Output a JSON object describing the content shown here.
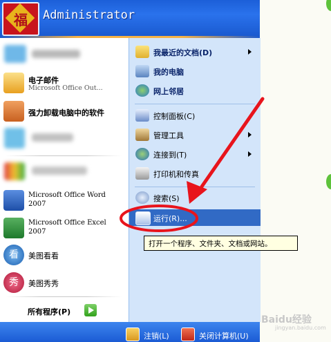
{
  "header": {
    "username": "Administrator",
    "avatar_glyph": "福"
  },
  "left_items": [
    {
      "icon": "outlook-mail-icon",
      "title": "电子邮件",
      "subtitle": "Microsoft Office Out..."
    },
    {
      "icon": "uninstall-tool-icon",
      "title": "强力卸载电脑中的软件"
    },
    {
      "icon": "word-icon",
      "title": "Microsoft Office Word",
      "subtitle": "2007"
    },
    {
      "icon": "excel-icon",
      "title": "Microsoft Office Excel",
      "subtitle": "2007"
    },
    {
      "icon": "meitu-kankan-icon",
      "title": "美图看看",
      "icon_glyph": "看"
    },
    {
      "icon": "meitu-xiuxiu-icon",
      "title": "美图秀秀",
      "icon_glyph": "秀"
    }
  ],
  "all_programs": "所有程序(P)",
  "right_items": [
    {
      "label": "我最近的文档(D)",
      "bold": true,
      "submenu": true,
      "icon": "folder-icon"
    },
    {
      "label": "我的电脑",
      "bold": true,
      "icon": "my-computer-icon"
    },
    {
      "label": "网上邻居",
      "bold": true,
      "icon": "network-icon"
    },
    {
      "label": "控制面板(C)",
      "icon": "control-panel-icon"
    },
    {
      "label": "管理工具",
      "submenu": true,
      "icon": "admin-tools-icon"
    },
    {
      "label": "连接到(T)",
      "submenu": true,
      "icon": "connect-icon"
    },
    {
      "label": "打印机和传真",
      "icon": "printer-icon"
    },
    {
      "label": "搜索(S)",
      "icon": "search-icon"
    },
    {
      "label": "运行(R)...",
      "icon": "run-icon",
      "highlighted": true
    }
  ],
  "tooltip": "打开一个程序、文件夹、文档或网站。",
  "footer": {
    "logoff": "注销(L)",
    "shutdown": "关闭计算机(U)"
  },
  "watermark": {
    "brand": "Baidu经验",
    "url": "jingyan.baidu.com"
  },
  "colors": {
    "header_blue": "#2a72ec",
    "right_pane": "#d3e5fa",
    "highlight": "#316ac5",
    "annotation_red": "#e8141c"
  }
}
